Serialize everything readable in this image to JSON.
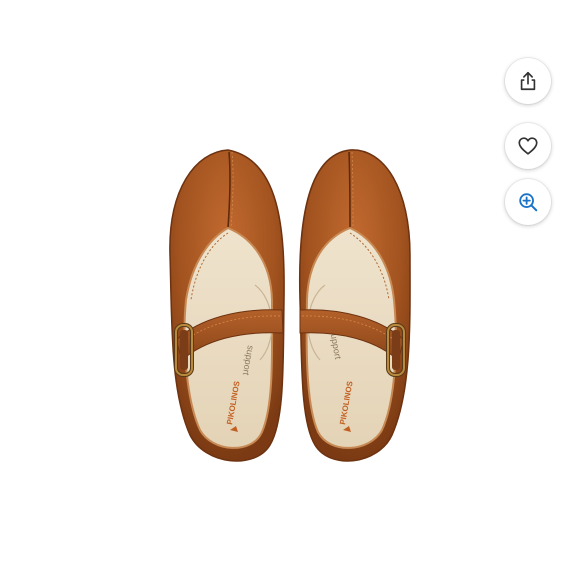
{
  "product": {
    "image_alt": "Pikolinos leather mary jane shoes, top view",
    "brand_insole_text": "PIKOLINOS",
    "insole_stamp_text": "support",
    "colors": {
      "leather": "#a85a2a",
      "leather_dark": "#7a3d17",
      "insole": "#eadbc2",
      "strap_edge": "#c77a3e"
    }
  },
  "actions": {
    "share": {
      "icon": "share-icon",
      "color": "#333333"
    },
    "like": {
      "icon": "heart-icon",
      "color": "#333333"
    },
    "zoom": {
      "icon": "zoom-in-icon",
      "color": "#1a73c7"
    }
  }
}
